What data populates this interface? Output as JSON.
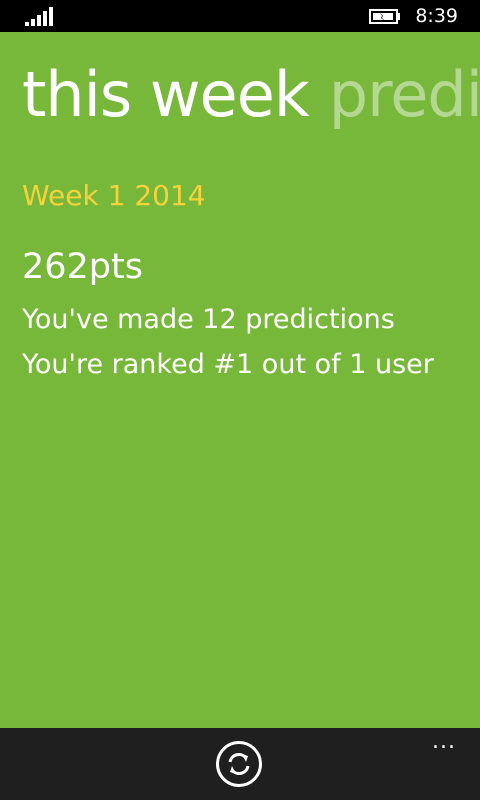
{
  "status_bar": {
    "time": "8:39",
    "signal_icon": "signal-bars-icon",
    "battery_icon": "battery-charging-icon"
  },
  "pivot": {
    "current": "this week",
    "next": "predi"
  },
  "week": {
    "label": "Week 1 2014"
  },
  "stats": {
    "points": "262pts",
    "predictions": "You've made 12 predictions",
    "rank": "You're ranked #1 out of 1 user"
  },
  "app_bar": {
    "refresh_icon": "refresh-icon",
    "more_label": "..."
  },
  "colors": {
    "background": "#77b83a",
    "accent": "#f5d33b",
    "app_bar": "#1f1f1f",
    "status_bar": "#000000"
  }
}
